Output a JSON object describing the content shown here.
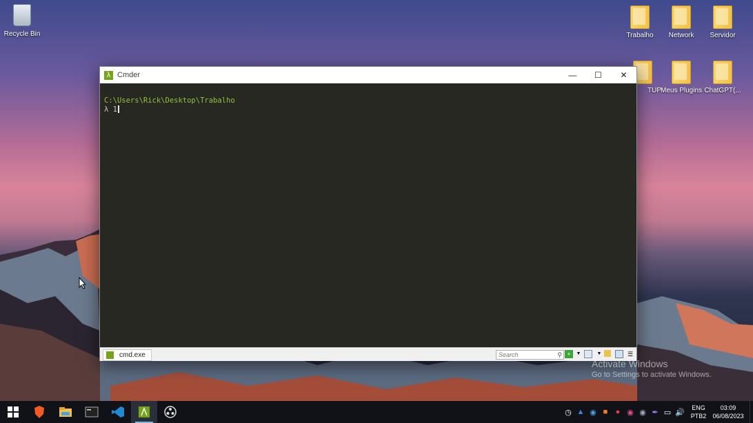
{
  "desktop": {
    "icons": [
      {
        "label": "Recycle Bin",
        "icon": "recycle-bin-icon"
      },
      {
        "label": "Trabalho",
        "icon": "trabalho-shortcut-icon"
      },
      {
        "label": "Network",
        "icon": "folder-icon"
      },
      {
        "label": "Servidor",
        "icon": "servidor-shortcut-icon"
      },
      {
        "label": "TUP",
        "icon": "shortcut-icon"
      },
      {
        "label": "Meus Plugins",
        "icon": "folder-icon"
      },
      {
        "label": "ChatGPT(...",
        "icon": "folder-icon"
      }
    ],
    "watermark": {
      "title": "Activate Windows",
      "subtitle": "Go to Settings to activate Windows."
    }
  },
  "window": {
    "title": "Cmder",
    "console": {
      "path_line": "C:\\Users\\Rick\\Desktop\\Trabalho",
      "prompt_symbol": "λ",
      "input": "1"
    },
    "statusbar": {
      "tab_label": "cmd.exe",
      "search_placeholder": "Search"
    }
  },
  "taskbar": {
    "apps": [
      "start-icon",
      "brave-icon",
      "file-explorer-icon",
      "terminal-icon",
      "vscode-icon",
      "cmder-icon",
      "obs-icon"
    ],
    "language": {
      "line1": "ENG",
      "line2": "PTB2"
    },
    "clock": {
      "time": "03:09",
      "date": "06/08/2023"
    }
  },
  "colors": {
    "console_bg": "#272822",
    "path_green": "#8fc33a",
    "cmder_green": "#75a31b",
    "taskbar_bg": "#101218"
  }
}
